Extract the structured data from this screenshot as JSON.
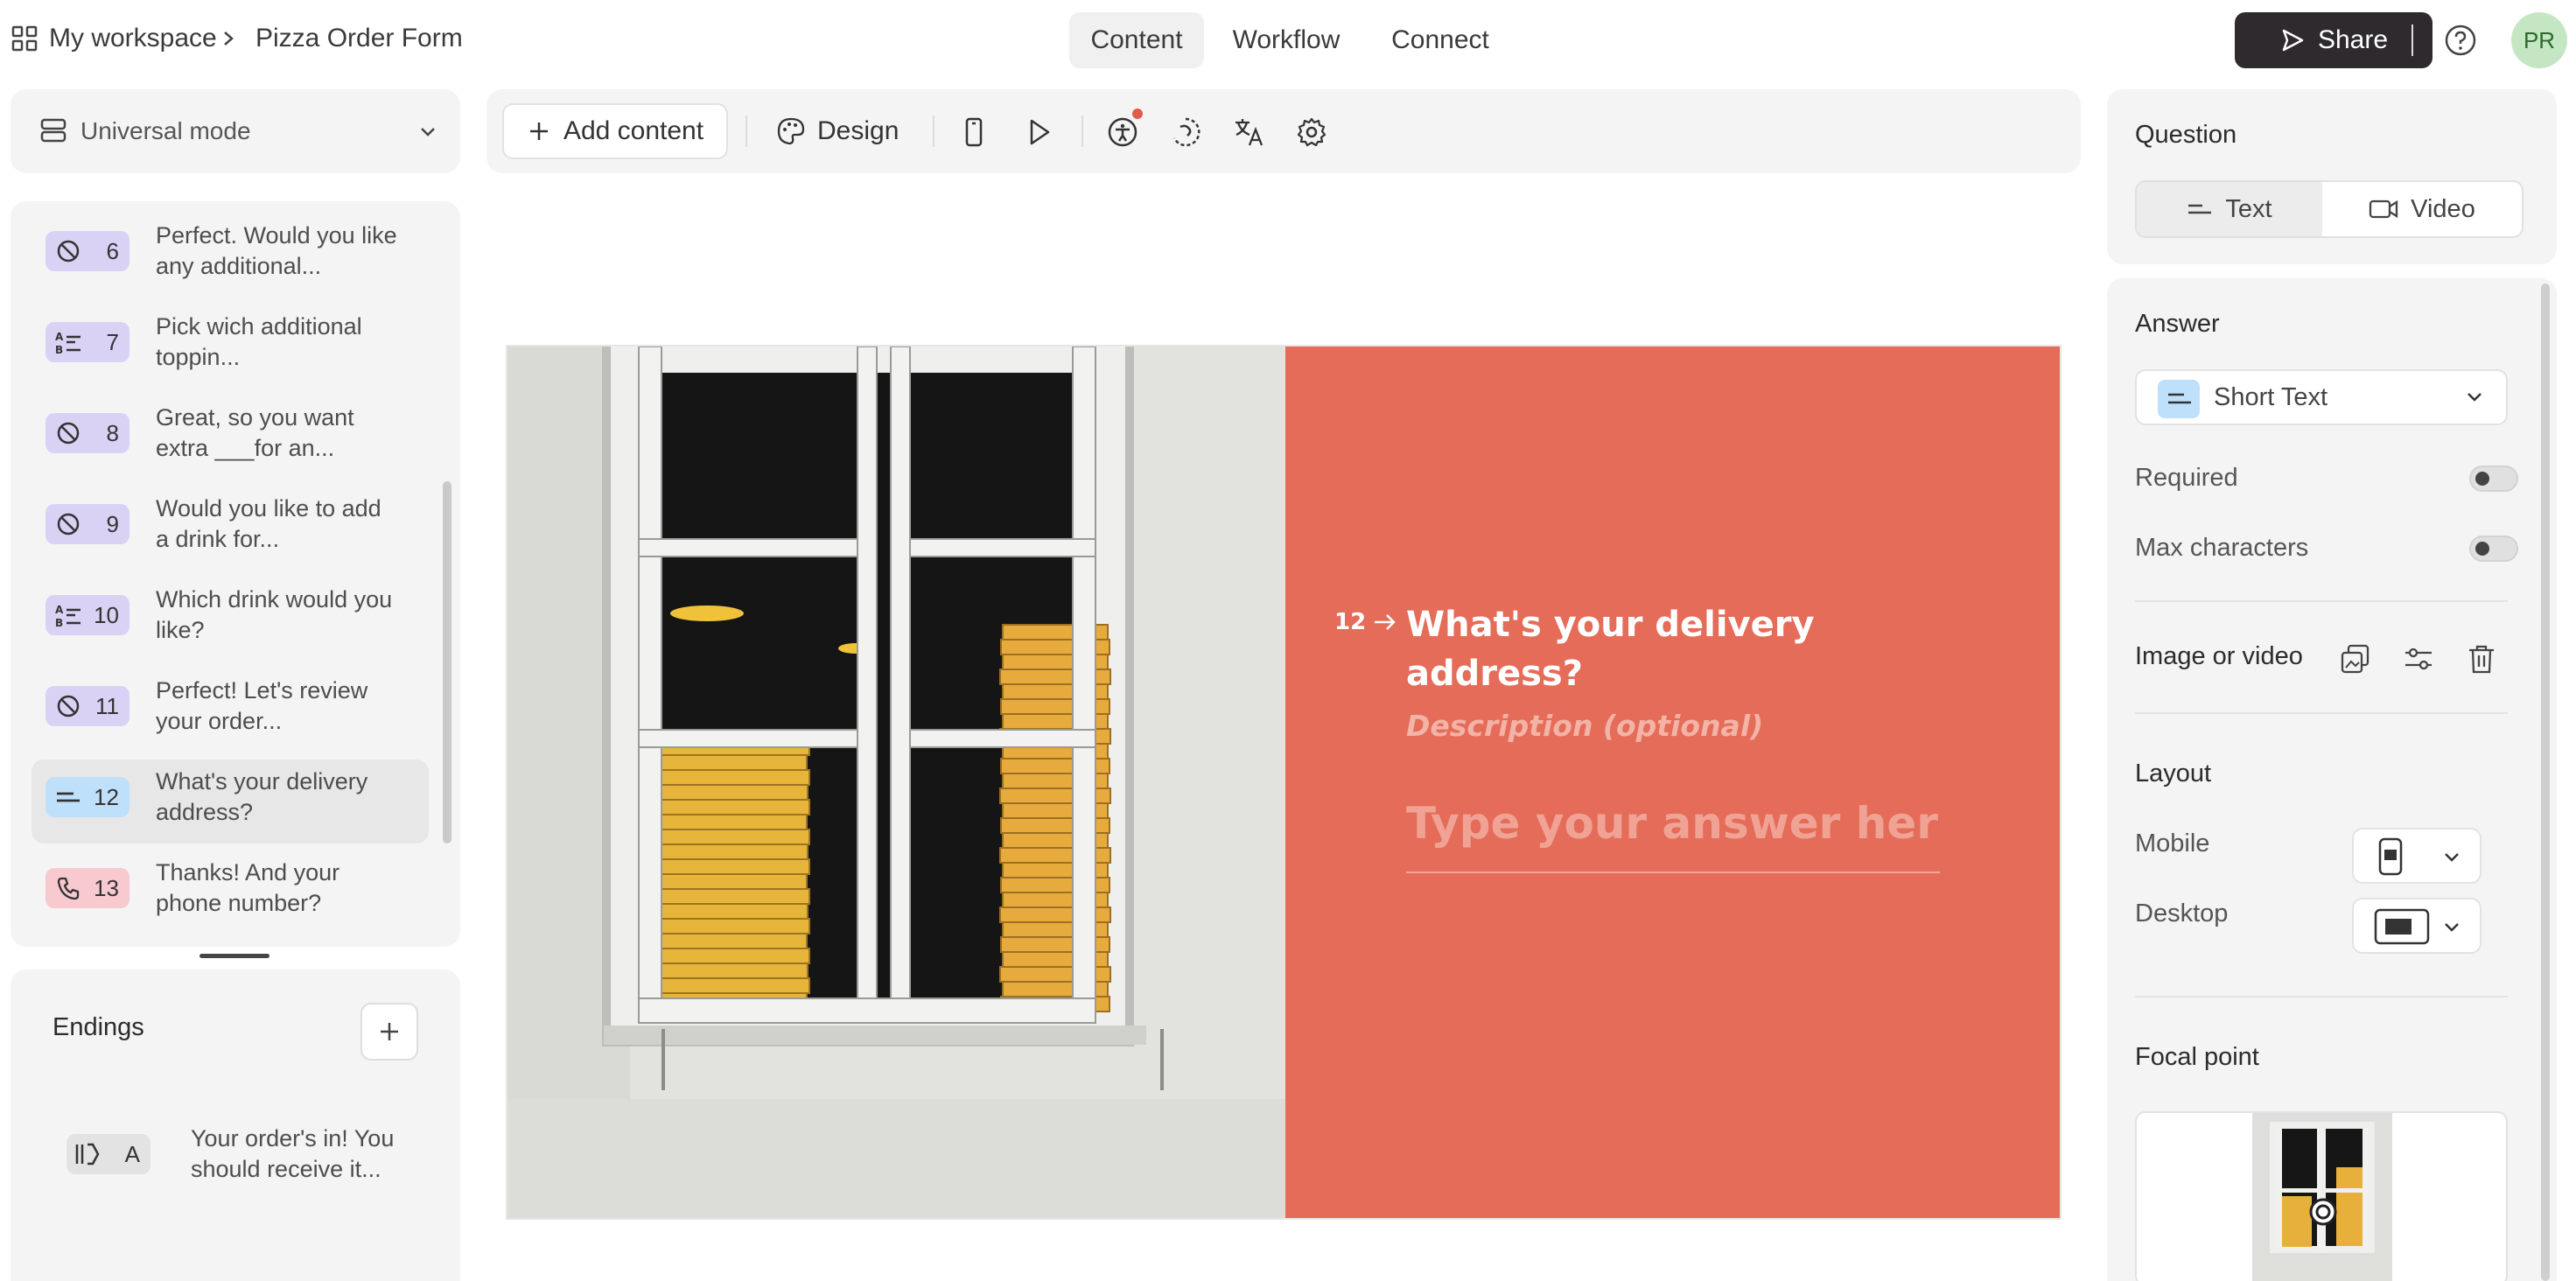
{
  "breadcrumb": {
    "workspace": "My workspace",
    "form": "Pizza Order Form"
  },
  "nav_tabs": [
    {
      "label": "Content",
      "active": true
    },
    {
      "label": "Workflow",
      "active": false
    },
    {
      "label": "Connect",
      "active": false
    }
  ],
  "share_label": "Share",
  "avatar_initials": "PR",
  "mode_selector": {
    "label": "Universal mode"
  },
  "questions": [
    {
      "num": "6",
      "type": "statement",
      "text": "Perfect. Would you like any additional...",
      "color": "#d9d2f5"
    },
    {
      "num": "7",
      "type": "multiple-choice",
      "text": "Pick wich additional toppin...",
      "color": "#d9d2f5"
    },
    {
      "num": "8",
      "type": "statement",
      "text": "Great, so you want extra ___for an...",
      "color": "#d9d2f5"
    },
    {
      "num": "9",
      "type": "statement",
      "text": "Would you like to add a drink for...",
      "color": "#d9d2f5"
    },
    {
      "num": "10",
      "type": "multiple-choice",
      "text": "Which drink would you like?",
      "color": "#d9d2f5"
    },
    {
      "num": "11",
      "type": "statement",
      "text": "Perfect! Let's review your order...",
      "color": "#d9d2f5"
    },
    {
      "num": "12",
      "type": "short-text",
      "text": "What's your delivery address?",
      "color": "#bfe0fb",
      "active": true
    },
    {
      "num": "13",
      "type": "phone",
      "text": "Thanks! And your phone number?",
      "color": "#f8c9cf"
    }
  ],
  "endings": {
    "title": "Endings",
    "items": [
      {
        "letter": "A",
        "text": "Your order's in! You should receive it..."
      }
    ]
  },
  "toolbar": {
    "add_content": "Add content",
    "design": "Design"
  },
  "canvas": {
    "question_number": "12",
    "title": "What's your delivery address?",
    "description": "Description (optional)",
    "answer_placeholder": "Type your answer here...",
    "accent_color": "#e46c58"
  },
  "settings": {
    "question_label": "Question",
    "question_tabs": [
      {
        "label": "Text",
        "active": true
      },
      {
        "label": "Video",
        "active": false
      }
    ],
    "answer_label": "Answer",
    "answer_type": "Short Text",
    "required_label": "Required",
    "required": false,
    "max_chars_label": "Max characters",
    "max_chars": false,
    "image_or_video_label": "Image or video",
    "layout_label": "Layout",
    "mobile_label": "Mobile",
    "desktop_label": "Desktop",
    "focal_point_label": "Focal point"
  }
}
